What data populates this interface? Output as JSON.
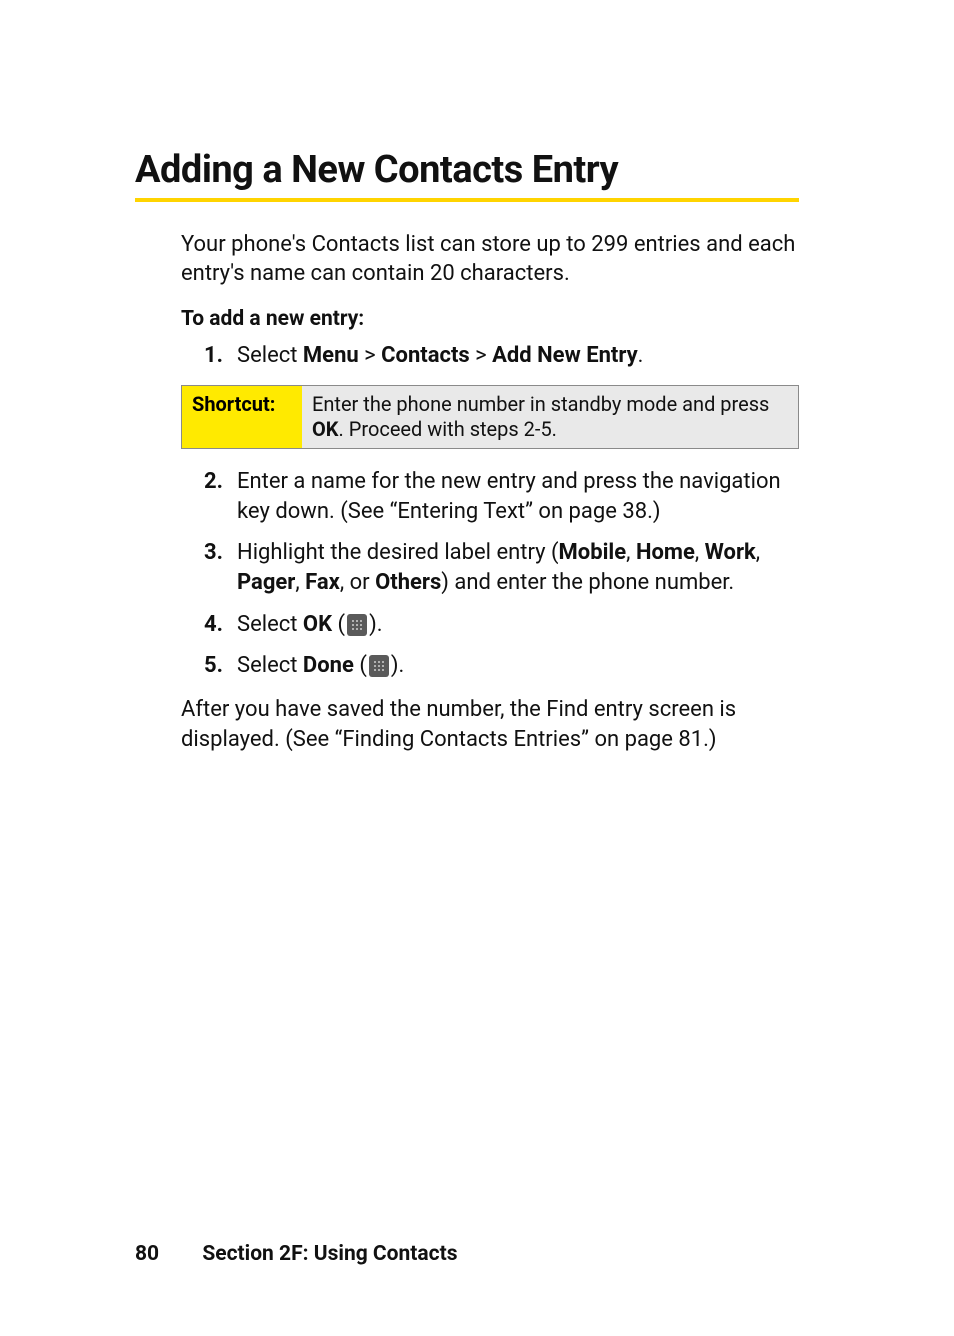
{
  "heading": "Adding a New Contacts Entry",
  "intro": "Your phone's Contacts list can store up to 299 entries and each entry's name can contain 20 characters.",
  "subhead": "To add a new entry:",
  "step1": {
    "num": "1.",
    "pre": "Select ",
    "menu": "Menu",
    "gt1": " > ",
    "contacts": "Contacts",
    "gt2": " > ",
    "addnew": "Add New Entry",
    "post": "."
  },
  "shortcut": {
    "label": "Shortcut:",
    "pre": "Enter the phone number in standby mode and press ",
    "ok": "OK",
    "post": ". Proceed with steps 2-5."
  },
  "step2": {
    "num": "2.",
    "text": "Enter a name for the new entry and press the navigation key down. (See “Entering Text” on page 38.)"
  },
  "step3": {
    "num": "3.",
    "pre": "Highlight the desired label entry (",
    "l1": "Mobile",
    "c1": ", ",
    "l2": "Home",
    "c2": ", ",
    "l3": "Work",
    "c3": ", ",
    "l4": "Pager",
    "c4": ", ",
    "l5": "Fax",
    "c5": ", or ",
    "l6": "Others",
    "post": ") and enter the phone number."
  },
  "step4": {
    "num": "4.",
    "pre": "Select ",
    "ok": "OK",
    "open": " (",
    "close": ")."
  },
  "step5": {
    "num": "5.",
    "pre": "Select ",
    "done": "Done",
    "open": " (",
    "close": ")."
  },
  "closing": "After you have saved the number, the Find entry screen is displayed. (See “Finding Contacts Entries” on page 81.)",
  "footer": {
    "page": "80",
    "section": "Section 2F: Using Contacts"
  }
}
